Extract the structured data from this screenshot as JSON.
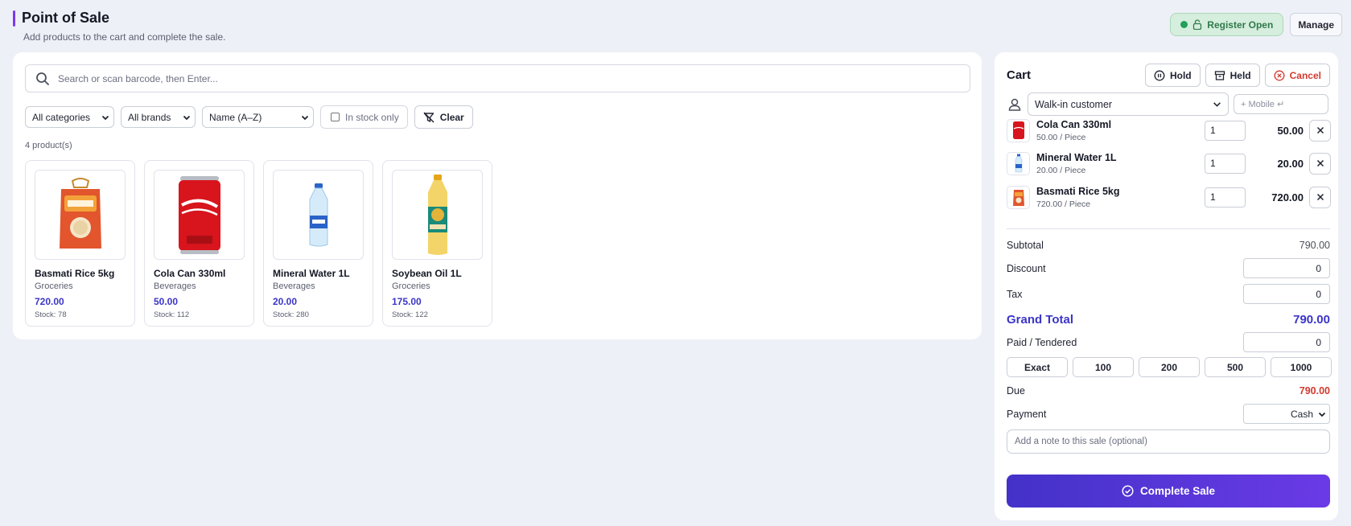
{
  "header": {
    "title": "Point of Sale",
    "subtitle": "Add products to the cart and complete the sale.",
    "register_label": "Register Open",
    "manage_label": "Manage"
  },
  "search": {
    "placeholder": "Search or scan barcode, then Enter..."
  },
  "filters": {
    "category": "All categories",
    "brand": "All brands",
    "sort": "Name (A–Z)",
    "in_stock_label": "In stock only",
    "clear_label": "Clear"
  },
  "product_count": "4 product(s)",
  "products": [
    {
      "name": "Basmati Rice 5kg",
      "category": "Groceries",
      "price": "720.00",
      "stock": "Stock: 78",
      "icon": "rice-bag-image"
    },
    {
      "name": "Cola Can 330ml",
      "category": "Beverages",
      "price": "50.00",
      "stock": "Stock: 112",
      "icon": "cola-can-image"
    },
    {
      "name": "Mineral Water 1L",
      "category": "Beverages",
      "price": "20.00",
      "stock": "Stock: 280",
      "icon": "water-bottle-image"
    },
    {
      "name": "Soybean Oil 1L",
      "category": "Groceries",
      "price": "175.00",
      "stock": "Stock: 122",
      "icon": "oil-bottle-image"
    }
  ],
  "cart": {
    "title": "Cart",
    "hold_label": "Hold",
    "held_label": "Held",
    "cancel_label": "Cancel",
    "customer": "Walk-in customer",
    "mobile_placeholder": "+ Mobile ↵",
    "items": [
      {
        "name": "Cola Can 330ml",
        "unit": "50.00 / Piece",
        "qty": "1",
        "total": "50.00"
      },
      {
        "name": "Mineral Water 1L",
        "unit": "20.00 / Piece",
        "qty": "1",
        "total": "20.00"
      },
      {
        "name": "Basmati Rice 5kg",
        "unit": "720.00 / Piece",
        "qty": "1",
        "total": "720.00"
      }
    ],
    "subtotal_label": "Subtotal",
    "subtotal": "790.00",
    "discount_label": "Discount",
    "discount": "0",
    "tax_label": "Tax",
    "tax": "0",
    "grand_total_label": "Grand Total",
    "grand_total": "790.00",
    "paid_label": "Paid / Tendered",
    "paid": "0",
    "tender_buttons": [
      "Exact",
      "100",
      "200",
      "500",
      "1000"
    ],
    "due_label": "Due",
    "due": "790.00",
    "payment_label": "Payment",
    "payment_method": "Cash",
    "note_placeholder": "Add a note to this sale (optional)",
    "complete_label": "Complete Sale"
  },
  "colors": {
    "accent": "#3b35c7",
    "danger": "#d33a2f",
    "success": "#22a05a",
    "complete_gradient_start": "#4332c8",
    "complete_gradient_end": "#6a3ae6"
  }
}
